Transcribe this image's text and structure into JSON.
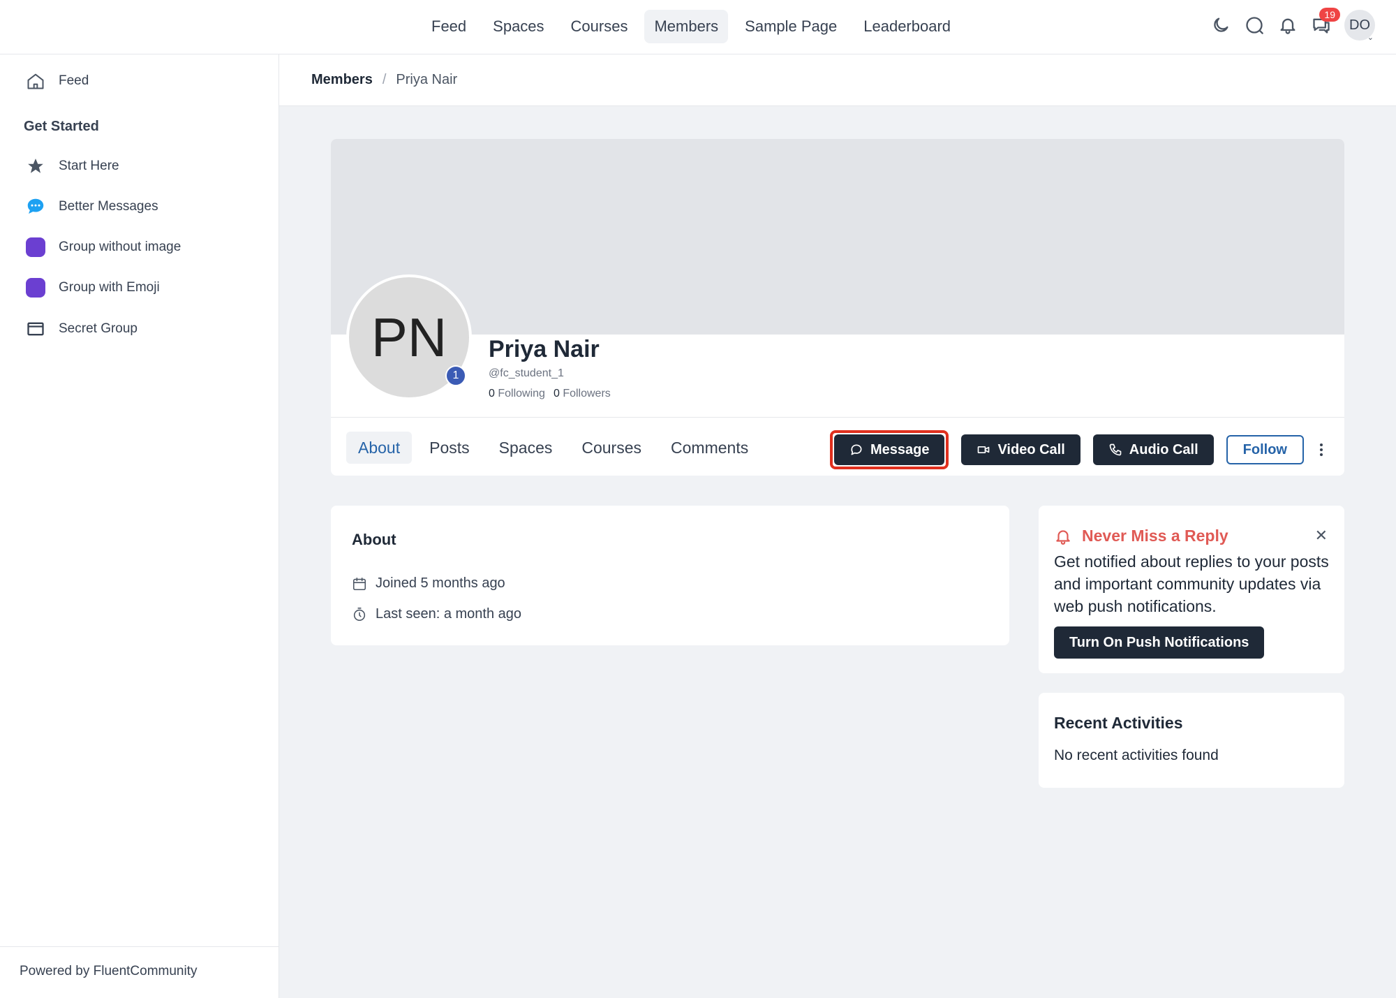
{
  "topnav": {
    "items": [
      {
        "label": "Feed"
      },
      {
        "label": "Spaces"
      },
      {
        "label": "Courses"
      },
      {
        "label": "Members"
      },
      {
        "label": "Sample Page"
      },
      {
        "label": "Leaderboard"
      }
    ],
    "active": "Members",
    "chat_badge": "19",
    "user_initials": "DO"
  },
  "sidebar": {
    "feed_label": "Feed",
    "heading": "Get Started",
    "items": [
      {
        "label": "Start Here",
        "icon": "star-icon"
      },
      {
        "label": "Better Messages",
        "icon": "chat-bubble-icon"
      },
      {
        "label": "Group without image",
        "icon": "purple-square-icon"
      },
      {
        "label": "Group with Emoji",
        "icon": "purple-square-icon"
      },
      {
        "label": "Secret Group",
        "icon": "card-icon"
      }
    ],
    "footer": "Powered by FluentCommunity"
  },
  "breadcrumb": {
    "parent": "Members",
    "separator": "/",
    "current": "Priya Nair"
  },
  "profile": {
    "initials": "PN",
    "level": "1",
    "name": "Priya Nair",
    "handle": "@fc_student_1",
    "following_count": "0",
    "following_label": "Following",
    "followers_count": "0",
    "followers_label": "Followers",
    "tabs": [
      {
        "label": "About"
      },
      {
        "label": "Posts"
      },
      {
        "label": "Spaces"
      },
      {
        "label": "Courses"
      },
      {
        "label": "Comments"
      }
    ],
    "active_tab": "About",
    "actions": {
      "message": "Message",
      "video_call": "Video Call",
      "audio_call": "Audio Call",
      "follow": "Follow"
    }
  },
  "about": {
    "title": "About",
    "joined": "Joined 5 months ago",
    "last_seen": "Last seen: a month ago"
  },
  "notification": {
    "title": "Never Miss a Reply",
    "body": "Get notified about replies to your posts and important community updates via web push notifications.",
    "button": "Turn On Push Notifications"
  },
  "recent": {
    "title": "Recent Activities",
    "empty": "No recent activities found"
  },
  "colors": {
    "accent": "#2563a8",
    "dark_button": "#1f2937",
    "alert": "#e05a55",
    "highlight": "#e0301e",
    "group_purple": "#6b3fd1"
  }
}
